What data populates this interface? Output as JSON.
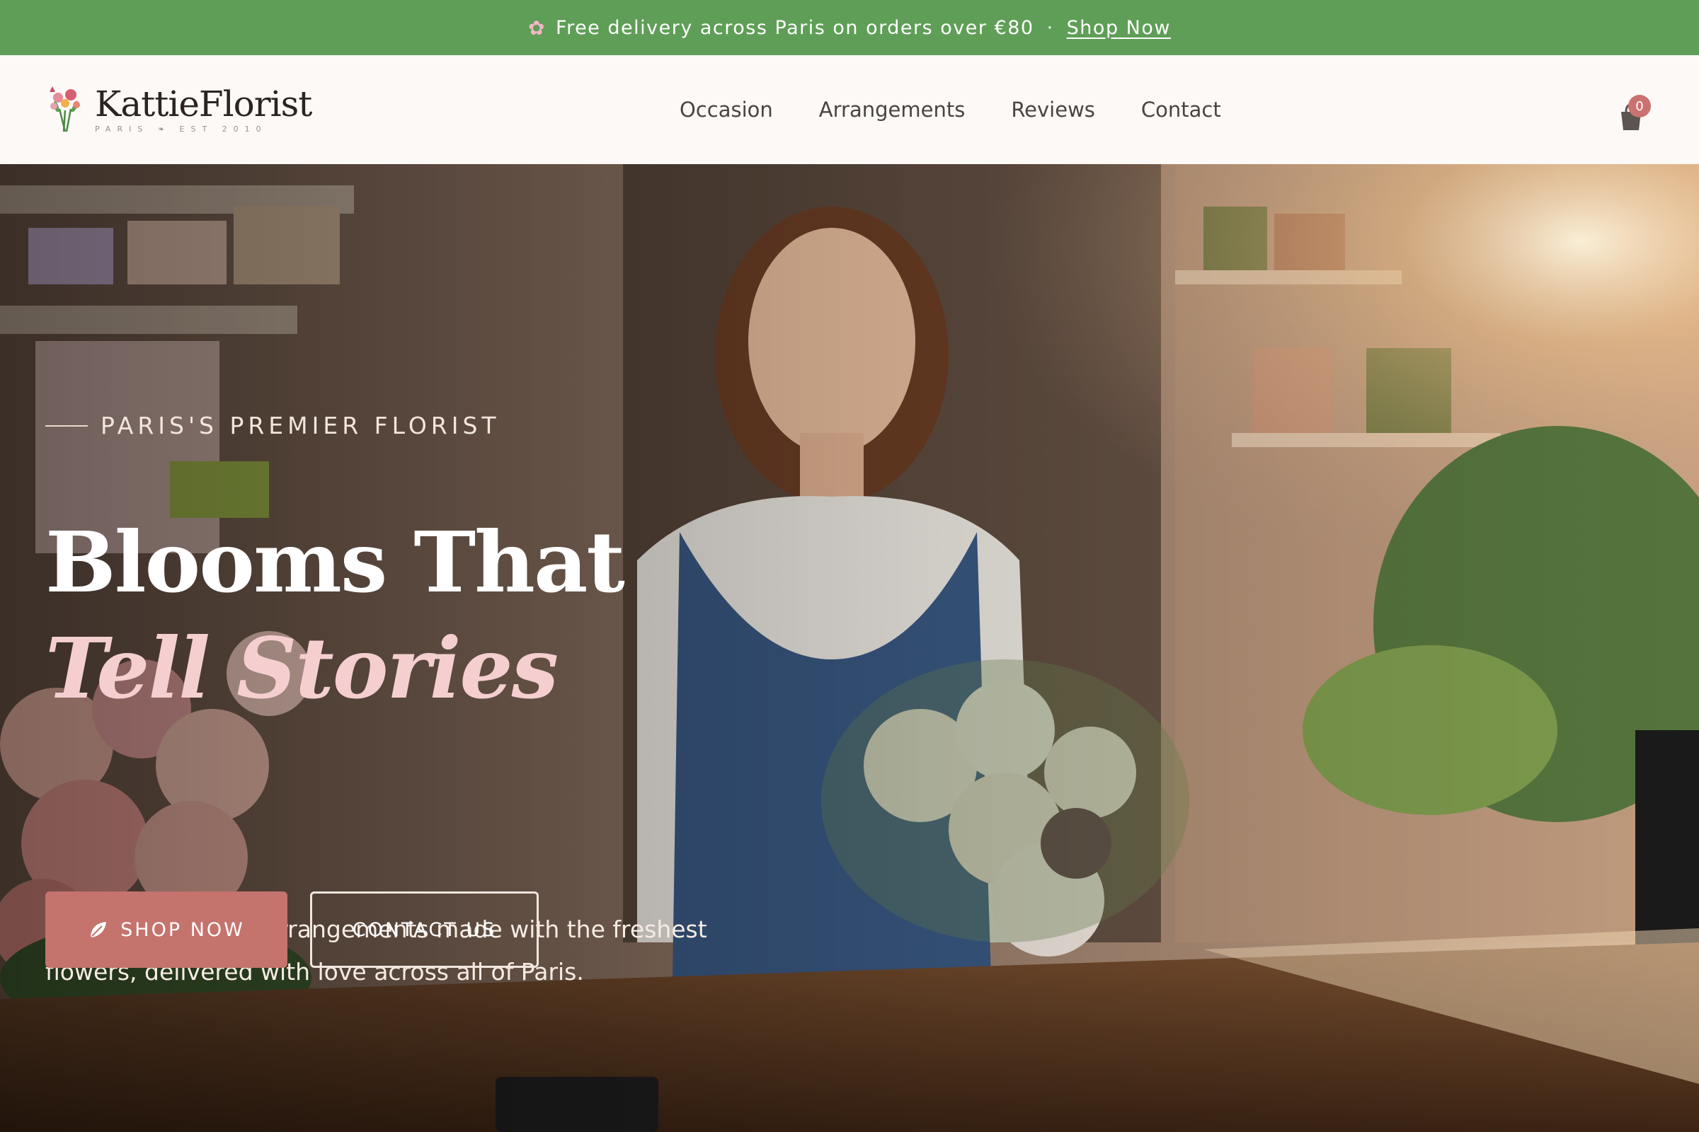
{
  "announcement": {
    "text": "Free delivery across Paris on orders over €80",
    "separator": "·",
    "link_label": "Shop Now",
    "icon": "flower-icon"
  },
  "header": {
    "logo_text": "KattieFlorist",
    "logo_sub": "PARIS ❧ EST 2010",
    "nav": [
      {
        "label": "Occasion"
      },
      {
        "label": "Arrangements"
      },
      {
        "label": "Reviews"
      },
      {
        "label": "Contact"
      }
    ],
    "cart_count": "0",
    "cart_icon": "shopping-bag-icon"
  },
  "hero": {
    "eyebrow": "PARIS'S PREMIER FLORIST",
    "headline_line1": "Blooms That",
    "headline_line2": "Tell Stories",
    "subcopy": "Handcrafted floral arrangements made with the freshest flowers, delivered with love across all of Paris.",
    "primary_button": "SHOP NOW",
    "secondary_button": "CONTACT US"
  },
  "colors": {
    "announcement_bg": "#5f9e57",
    "accent": "#c4736d",
    "header_bg": "#fdf9f6",
    "headline_italic": "#f5cfd0"
  }
}
